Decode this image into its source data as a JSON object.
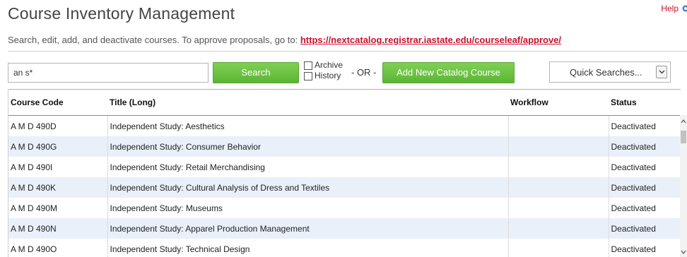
{
  "header": {
    "title": "Course Inventory Management",
    "help_label": "Help"
  },
  "intro": {
    "text": "Search, edit, add, and deactivate courses. To approve proposals, go to: ",
    "link": "https://nextcatalog.registrar.iastate.edu/courseleaf/approve/"
  },
  "search": {
    "value": "an s*",
    "button_label": "Search",
    "archive_label": "Archive",
    "history_label": "History",
    "or_label": "- OR -",
    "add_button_label": "Add New Catalog Course",
    "quick_search_label": "Quick Searches..."
  },
  "table": {
    "columns": [
      "Course Code",
      "Title (Long)",
      "Workflow",
      "Status"
    ],
    "rows": [
      {
        "code": "A M D 490D",
        "title": "Independent Study: Aesthetics",
        "workflow": "",
        "status": "Deactivated"
      },
      {
        "code": "A M D 490G",
        "title": "Independent Study: Consumer Behavior",
        "workflow": "",
        "status": "Deactivated"
      },
      {
        "code": "A M D 490I",
        "title": "Independent Study: Retail Merchandising",
        "workflow": "",
        "status": "Deactivated"
      },
      {
        "code": "A M D 490K",
        "title": "Independent Study: Cultural Analysis of Dress and Textiles",
        "workflow": "",
        "status": "Deactivated"
      },
      {
        "code": "A M D 490M",
        "title": "Independent Study: Museums",
        "workflow": "",
        "status": "Deactivated"
      },
      {
        "code": "A M D 490N",
        "title": "Independent Study: Apparel Production Management",
        "workflow": "",
        "status": "Deactivated"
      },
      {
        "code": "A M D 490O",
        "title": "Independent Study: Technical Design",
        "workflow": "",
        "status": "Deactivated"
      }
    ]
  },
  "colors": {
    "accent_red": "#c8102e",
    "button_green": "#5cb534",
    "row_stripe": "#eaf0fa"
  },
  "icons": {
    "help": "help-icon",
    "select_arrow": "chevron-down-icon"
  }
}
